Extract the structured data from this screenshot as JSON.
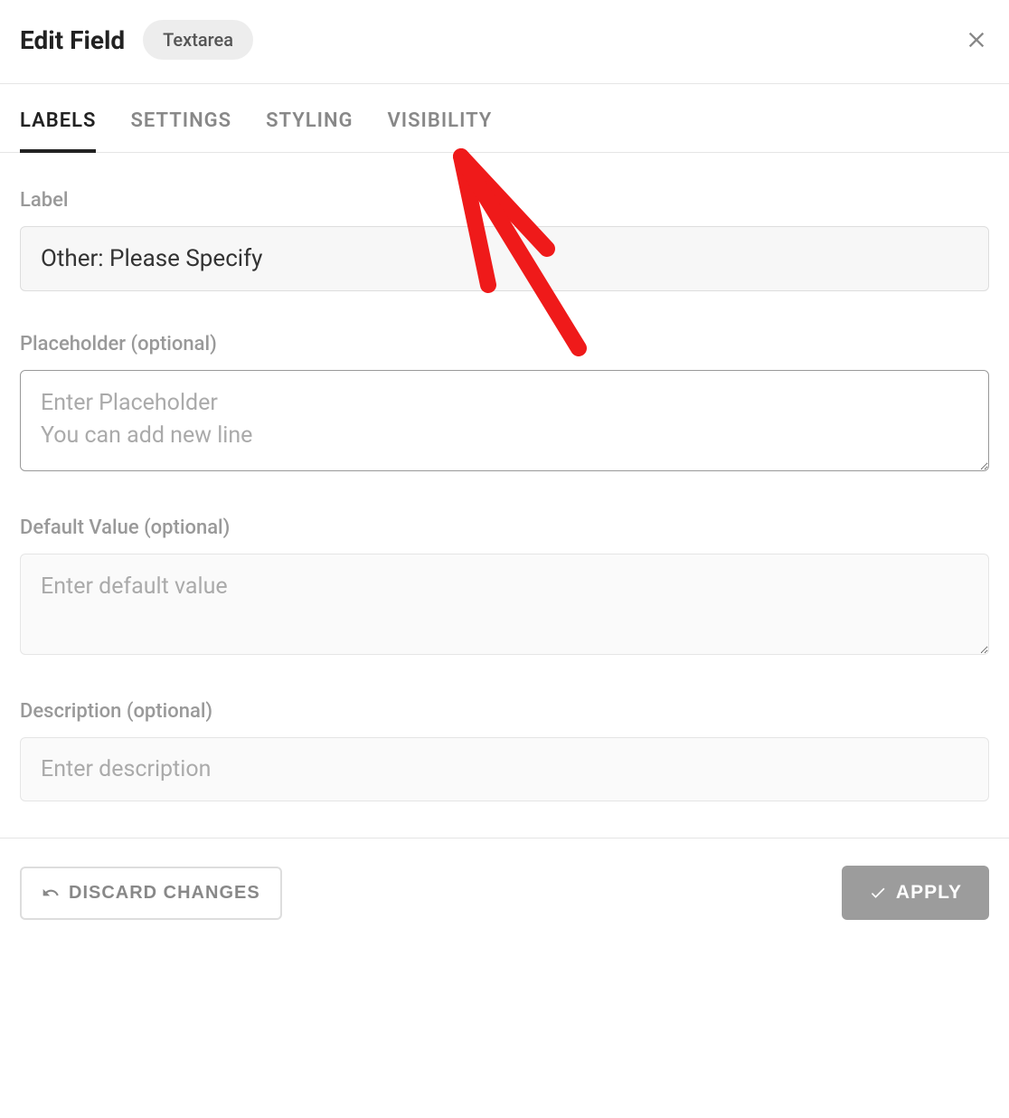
{
  "header": {
    "title": "Edit Field",
    "badge": "Textarea"
  },
  "tabs": {
    "labels": "Labels",
    "settings": "Settings",
    "styling": "Styling",
    "visibility": "Visibility"
  },
  "form": {
    "label": {
      "title": "Label",
      "value": "Other: Please Specify"
    },
    "placeholder": {
      "title": "Placeholder (optional)",
      "placeholder": "Enter Placeholder\nYou can add new line",
      "value": ""
    },
    "defaultValue": {
      "title": "Default Value (optional)",
      "placeholder": "Enter default value",
      "value": ""
    },
    "description": {
      "title": "Description (optional)",
      "placeholder": "Enter description",
      "value": ""
    }
  },
  "footer": {
    "discard": "DISCARD CHANGES",
    "apply": "APPLY"
  },
  "annotation": {
    "type": "arrow",
    "color": "#ef1a1a",
    "target": "visibility-tab"
  }
}
